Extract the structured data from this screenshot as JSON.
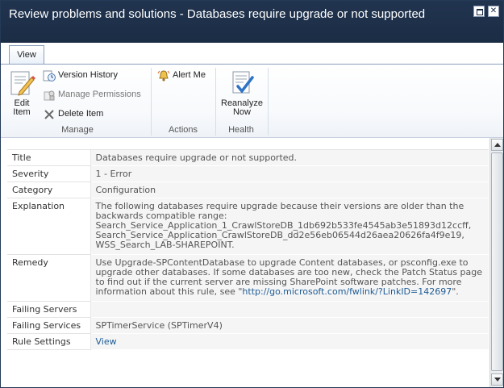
{
  "window": {
    "title": "Review problems and solutions - Databases require upgrade or not supported",
    "maximize_label": "",
    "close_label": "✕"
  },
  "ribbon": {
    "tab_view": "View",
    "groups": {
      "manage": {
        "label": "Manage",
        "edit_item": "Edit\nItem",
        "version_history": "Version History",
        "manage_permissions": "Manage Permissions",
        "delete_item": "Delete Item"
      },
      "actions": {
        "label": "Actions",
        "alert_me": "Alert Me"
      },
      "health": {
        "label": "Health",
        "reanalyze_now": "Reanalyze\nNow"
      }
    }
  },
  "properties": {
    "title": {
      "label": "Title",
      "value": "Databases require upgrade or not supported."
    },
    "severity": {
      "label": "Severity",
      "value": "1 - Error"
    },
    "category": {
      "label": "Category",
      "value": "Configuration"
    },
    "explanation": {
      "label": "Explanation",
      "value": "The following databases require upgrade because their versions are older than the backwards compatible range:\nSearch_Service_Application_1_CrawlStoreDB_1db692b533fe4545ab3e51893d12ccff,\nSearch_Service_Application_CrawlStoreDB_dd2e56eb06544d26aea20626fa4f9e19,\nWSS_Search_LAB-SHAREPOINT."
    },
    "remedy": {
      "label": "Remedy",
      "value": "Use Upgrade-SPContentDatabase to upgrade Content databases, or psconfig.exe to upgrade other databases. If some databases are too new, check the Patch Status page to find out if the current server are missing SharePoint software patches. For more information about this rule, see \"",
      "link": "http://go.microsoft.com/fwlink/?LinkID=142697",
      "suffix": "\"."
    },
    "failing_servers": {
      "label": "Failing Servers",
      "value": ""
    },
    "failing_services": {
      "label": "Failing Services",
      "value": "SPTimerService (SPTimerV4)"
    },
    "rule_settings": {
      "label": "Rule Settings",
      "link": "View"
    }
  },
  "colors": {
    "titlebar": "#1b2c45",
    "link": "#1f5c96",
    "value_bg": "#f5f5f5"
  }
}
